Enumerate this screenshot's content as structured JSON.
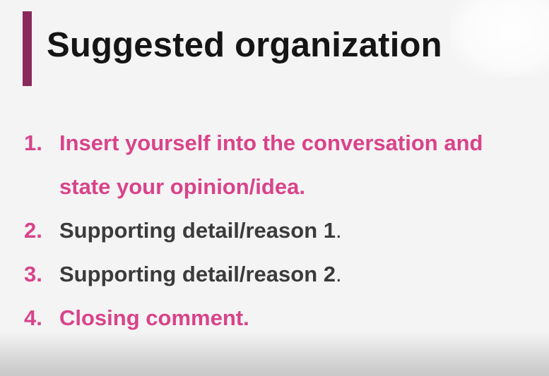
{
  "slide": {
    "title": "Suggested organization",
    "items": [
      {
        "number": "1.",
        "lines": [
          "Insert yourself into the conversation and",
          "state your opinion/idea."
        ],
        "suffix": ""
      },
      {
        "number": "2.",
        "lines": [
          "Supporting detail/reason 1"
        ],
        "suffix": "."
      },
      {
        "number": "3.",
        "lines": [
          "Supporting detail/reason 2"
        ],
        "suffix": "."
      },
      {
        "number": "4.",
        "lines": [
          "Closing comment."
        ],
        "suffix": ""
      }
    ]
  },
  "colors": {
    "accent_bar": "#8a2a5c",
    "highlight_text": "#d9438a",
    "body_text": "#3b3b3b",
    "title_text": "#151515",
    "background": "#f4f4f4"
  }
}
